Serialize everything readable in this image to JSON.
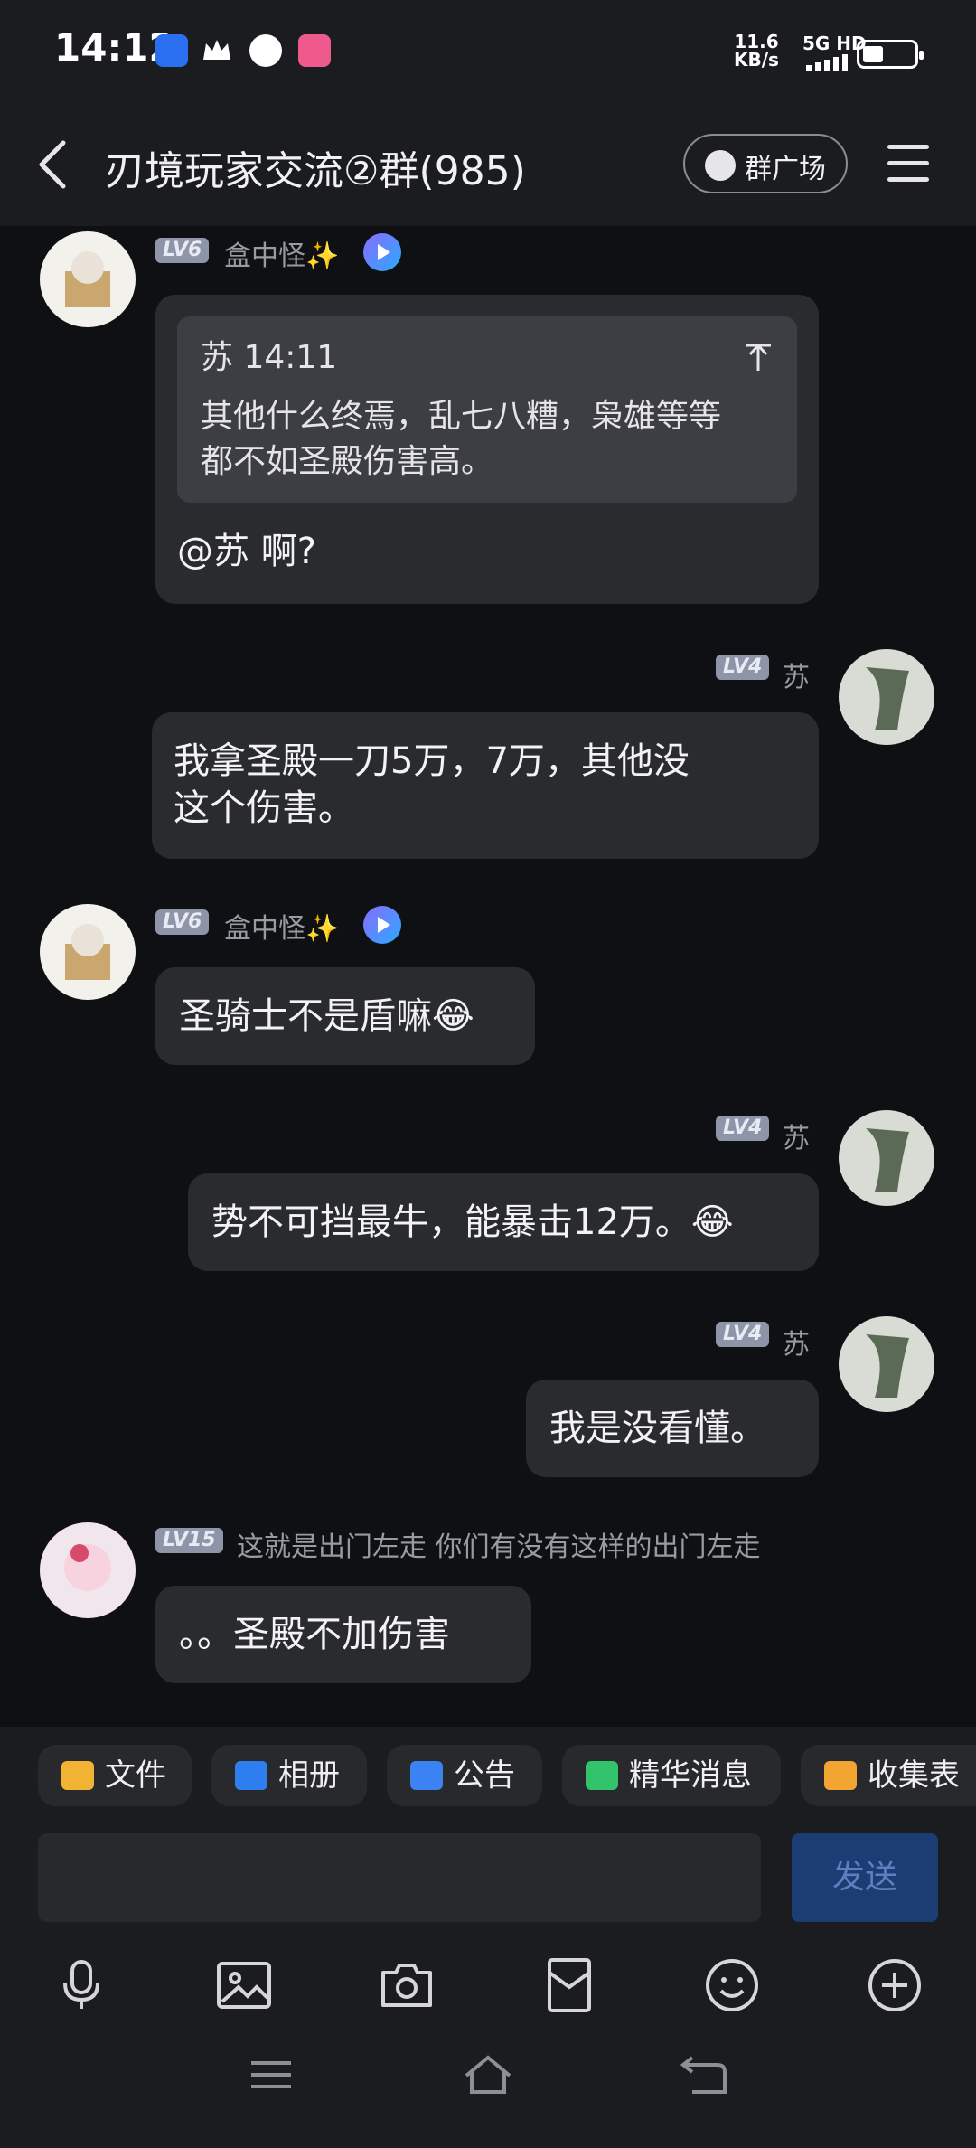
{
  "status_bar": {
    "time": "14:12",
    "net_speed_value": "11.6",
    "net_speed_unit": "KB/s",
    "signal_label": "5G HD",
    "app_icons": [
      "alipay-icon",
      "crown-icon",
      "cat-icon",
      "bilibili-icon"
    ]
  },
  "header": {
    "title": "刃境玩家交流②群(985)",
    "square_button": "群广场"
  },
  "messages": [
    {
      "side": "left",
      "level": "LV6",
      "nick": "盒中怪✨",
      "quote_author_time": "苏 14:11",
      "quote_text_1": "其他什么终焉，乱七八糟，枭雄等等",
      "quote_text_2": "都不如圣殿伤害高。",
      "text": "@苏 啊?"
    },
    {
      "side": "right",
      "level": "LV4",
      "nick": "苏",
      "text_1": "我拿圣殿一刀5万，7万，其他没",
      "text_2": "这个伤害。"
    },
    {
      "side": "left",
      "level": "LV6",
      "nick": "盒中怪✨",
      "text": "圣骑士不是盾嘛😂"
    },
    {
      "side": "right",
      "level": "LV4",
      "nick": "苏",
      "text": "势不可挡最牛，能暴击12万。😂"
    },
    {
      "side": "right",
      "level": "LV4",
      "nick": "苏",
      "text": "我是没看懂。"
    },
    {
      "side": "left",
      "level": "LV15",
      "nick": "这就是出门左走 你们有没有这样的出门左走",
      "text": "。。圣殿不加伤害"
    }
  ],
  "toolbar_chips": [
    "文件",
    "相册",
    "公告",
    "精华消息",
    "收集表"
  ],
  "input": {
    "placeholder": "",
    "send_label": "发送"
  },
  "bottom_icons": [
    "microphone-icon",
    "image-icon",
    "camera-icon",
    "red-packet-icon",
    "emoji-icon",
    "plus-icon"
  ],
  "colors": {
    "accent": "#1c3d74",
    "bubble": "#2a2b2f",
    "background": "#0f1013"
  }
}
